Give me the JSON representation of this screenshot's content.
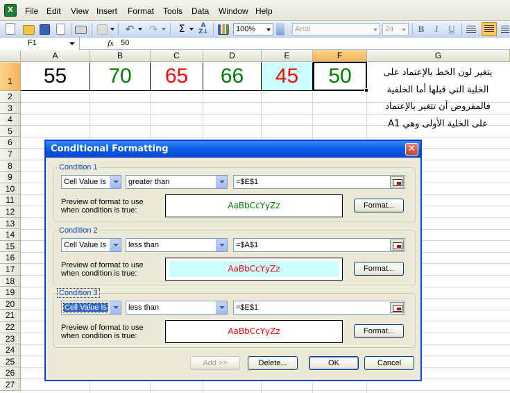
{
  "menubar": {
    "items": [
      "File",
      "Edit",
      "View",
      "Insert",
      "Format",
      "Tools",
      "Data",
      "Window",
      "Help"
    ]
  },
  "toolbar": {
    "zoom": "100%",
    "font_name": "Arial",
    "font_size": "24",
    "bold_label": "B",
    "italic_label": "I",
    "underline_label": "U",
    "sum_label": "Σ"
  },
  "formula_bar": {
    "name_box": "F1",
    "fx_label": "fx",
    "value": "50"
  },
  "sheet": {
    "columns": [
      "A",
      "B",
      "C",
      "D",
      "E",
      "F",
      "G"
    ],
    "selected_column": "F",
    "rows": [
      "1",
      "2",
      "3",
      "4",
      "5",
      "6",
      "7",
      "8",
      "9",
      "10",
      "11",
      "12",
      "13",
      "14",
      "15",
      "16",
      "17",
      "18",
      "19",
      "20",
      "21",
      "22",
      "23",
      "24",
      "25",
      "26",
      "27"
    ],
    "row1_cells": [
      {
        "col": "A",
        "value": "55",
        "color": "#000000",
        "fill": ""
      },
      {
        "col": "B",
        "value": "70",
        "color": "#008000",
        "fill": ""
      },
      {
        "col": "C",
        "value": "65",
        "color": "#ff0000",
        "fill": ""
      },
      {
        "col": "D",
        "value": "66",
        "color": "#008000",
        "fill": ""
      },
      {
        "col": "E",
        "value": "45",
        "color": "#ff0000",
        "fill": "#ccffff"
      },
      {
        "col": "F",
        "value": "50",
        "color": "#008000",
        "fill": ""
      }
    ],
    "note_lines": [
      "يتغير لون الخط بالإعتماد على",
      "الخلية التي قبلها أما الخلفية",
      "فالمفروض أن تتغير بالإعتماد",
      "على الخلية الأولى وهي A1"
    ]
  },
  "dialog": {
    "title": "Conditional Formatting",
    "conditions": [
      {
        "label": "Condition 1",
        "type": "Cell Value Is",
        "operator": "greater than",
        "reference": "=$E$1",
        "preview_label_line1": "Preview of format to use",
        "preview_label_line2": "when condition is true:",
        "preview_text": "AaBbCcYyZz",
        "preview_color": "#008000",
        "preview_fill": "",
        "format_button": "Format..."
      },
      {
        "label": "Condition 2",
        "type": "Cell Value Is",
        "operator": "less than",
        "reference": "=$A$1",
        "preview_label_line1": "Preview of format to use",
        "preview_label_line2": "when condition is true:",
        "preview_text": "AaBbCcYyZz",
        "preview_color": "#ff0000",
        "preview_fill": "#ccffff",
        "format_button": "Format..."
      },
      {
        "label": "Condition 3",
        "type": "Cell Value Is",
        "operator": "less than",
        "reference": "=$E$1",
        "preview_label_line1": "Preview of format to use",
        "preview_label_line2": "when condition is true:",
        "preview_text": "AaBbCcYyZz",
        "preview_color": "#ff0000",
        "preview_fill": "",
        "format_button": "Format..."
      }
    ],
    "add_button": "Add >>",
    "delete_button": "Delete...",
    "ok_button": "OK",
    "cancel_button": "Cancel"
  }
}
